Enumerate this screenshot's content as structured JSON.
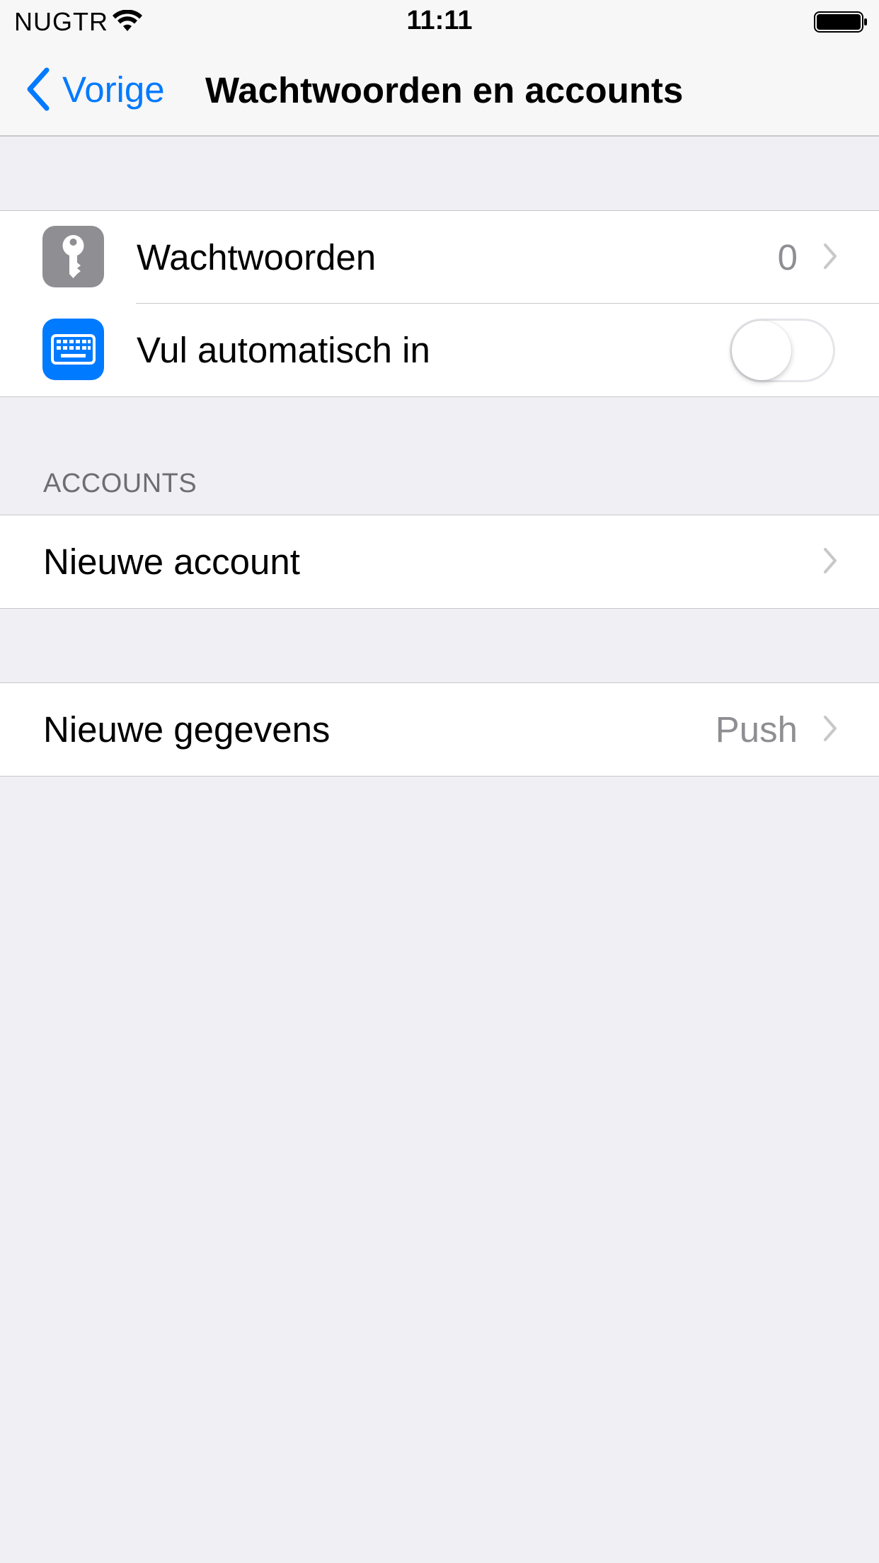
{
  "status_bar": {
    "carrier": "NUGTR",
    "time": "11:11",
    "wifi_icon": "wifi-icon",
    "battery_icon": "battery-full-icon"
  },
  "nav": {
    "back_label": "Vorige",
    "title": "Wachtwoorden en accounts",
    "accent_color": "#007aff"
  },
  "group1": {
    "passwords": {
      "label": "Wachtwoorden",
      "value": "0",
      "icon": "key-icon",
      "icon_color": "#8e8e93"
    },
    "autofill": {
      "label": "Vul automatisch in",
      "icon": "keyboard-icon",
      "icon_color": "#007aff",
      "toggle_on": false
    }
  },
  "accounts": {
    "header": "ACCOUNTS",
    "new_account_label": "Nieuwe account"
  },
  "fetch": {
    "label": "Nieuwe gegevens",
    "value": "Push"
  }
}
